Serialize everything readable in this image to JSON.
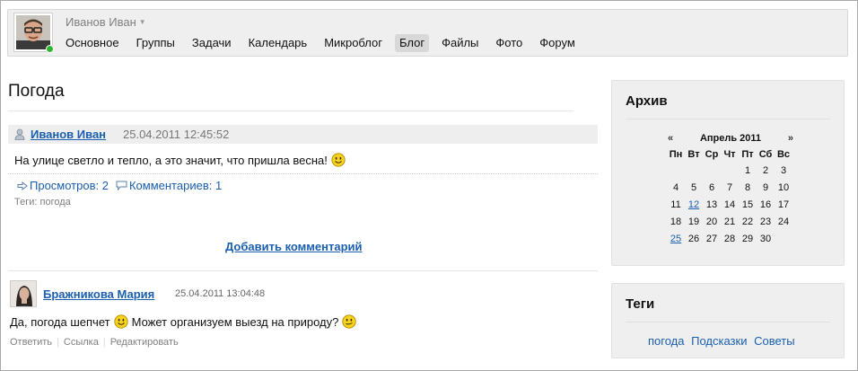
{
  "user": {
    "name": "Иванов Иван"
  },
  "nav": {
    "items": [
      {
        "label": "Основное"
      },
      {
        "label": "Группы"
      },
      {
        "label": "Задачи"
      },
      {
        "label": "Календарь"
      },
      {
        "label": "Микроблог"
      },
      {
        "label": "Блог",
        "active": true
      },
      {
        "label": "Файлы"
      },
      {
        "label": "Фото"
      },
      {
        "label": "Форум"
      }
    ]
  },
  "page": {
    "title": "Погода"
  },
  "post": {
    "author": "Иванов Иван",
    "date": "25.04.2011 12:45:52",
    "text": "На улице светло и тепло, а это значит, что пришла весна!",
    "views_label": "Просмотров: 2",
    "comments_label": "Комментариев: 1",
    "tags_text": "Теги: погода",
    "add_comment": "Добавить комментарий"
  },
  "comment": {
    "author": "Бражникова Мария",
    "date": "25.04.2011 13:04:48",
    "text_part1": "Да, погода шепчет",
    "text_part2": "Может организуем выезд на природу?",
    "actions": [
      "Ответить",
      "Ссылка",
      "Редактировать"
    ]
  },
  "archive": {
    "title": "Архив",
    "prev": "«",
    "next": "»",
    "month_label": "Апрель 2011",
    "weekdays": [
      "Пн",
      "Вт",
      "Ср",
      "Чт",
      "Пт",
      "Сб",
      "Вс"
    ],
    "weeks": [
      [
        "",
        "",
        "",
        "",
        "1",
        "2",
        "3"
      ],
      [
        "4",
        "5",
        "6",
        "7",
        "8",
        "9",
        "10"
      ],
      [
        "11",
        "12",
        "13",
        "14",
        "15",
        "16",
        "17"
      ],
      [
        "18",
        "19",
        "20",
        "21",
        "22",
        "23",
        "24"
      ],
      [
        "25",
        "26",
        "27",
        "28",
        "29",
        "30",
        ""
      ]
    ],
    "linked_days": [
      "12",
      "25"
    ]
  },
  "tags": {
    "title": "Теги",
    "items": [
      "погода",
      "Подсказки",
      "Советы"
    ]
  },
  "colors": {
    "link": "#1a5fb0",
    "panel_bg": "#efefef",
    "active_nav_bg": "#d8d8d8",
    "online_green": "#31b431",
    "smiley_yellow": "#f7d31d"
  },
  "icons": {
    "post_author": "person-icon",
    "views": "arrow-right-icon",
    "comments": "speech-bubble-icon",
    "emoticon": "smiley-icon",
    "status": "online-status-icon"
  }
}
